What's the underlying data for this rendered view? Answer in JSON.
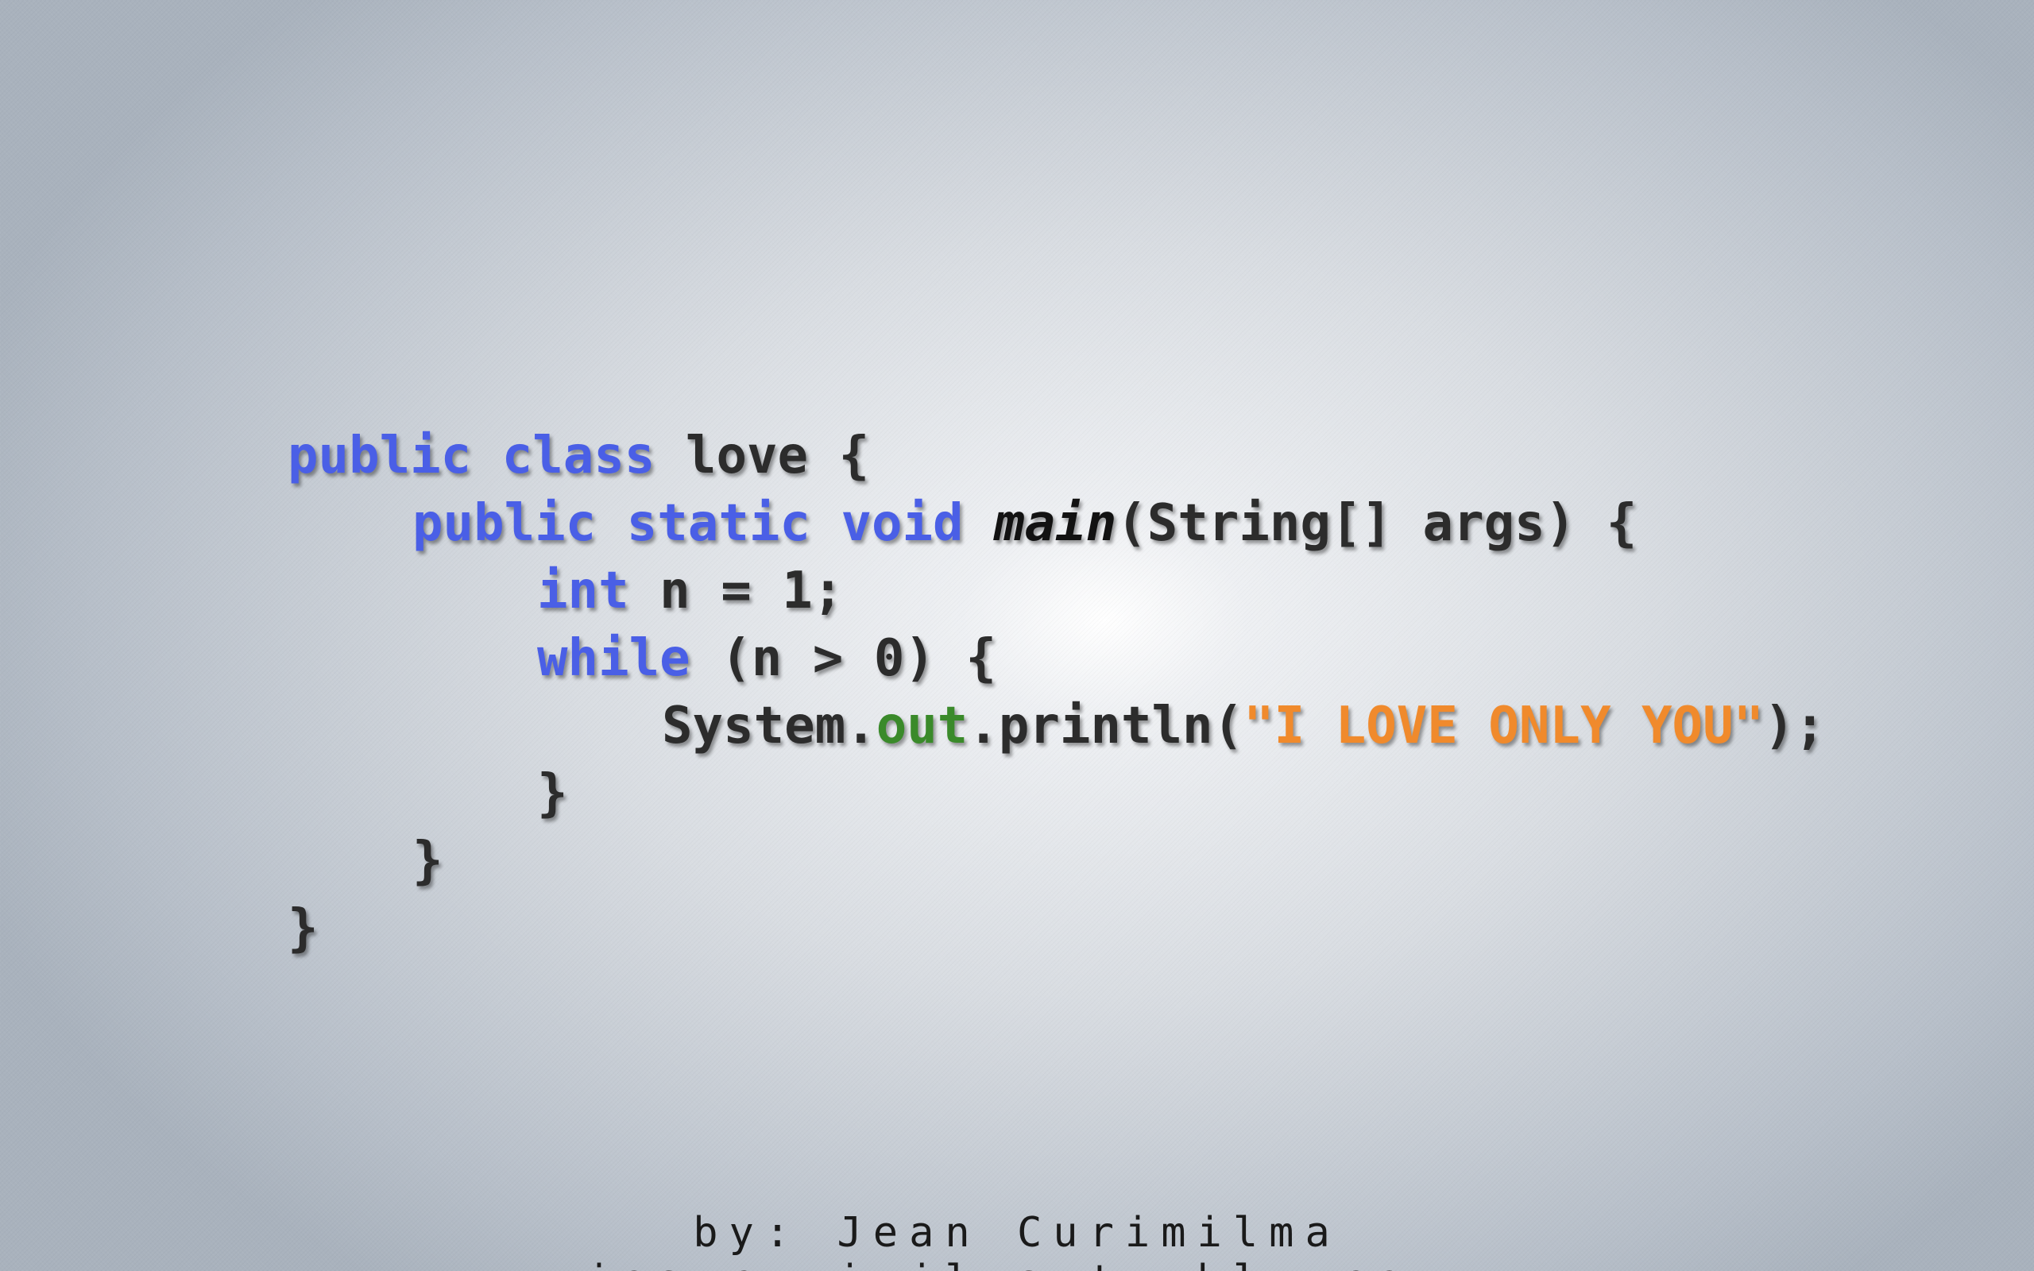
{
  "code": {
    "line1": {
      "kw_public": "public",
      "kw_class": "class",
      "rest": " love {"
    },
    "line2": {
      "kw_public": "public",
      "kw_static": "static",
      "kw_void": "void",
      "method": "main",
      "rest": "(String[] args) {"
    },
    "line3": {
      "kw_int": "int",
      "rest": " n = 1;"
    },
    "line4": {
      "kw_while": "while",
      "rest": " (n > 0) {"
    },
    "line5": {
      "pre": "System.",
      "field": "out",
      "mid": ".println(",
      "string": "\"I LOVE ONLY YOU\"",
      "post": ");"
    },
    "line6": "}",
    "line7": "}",
    "line8": "}"
  },
  "credit": {
    "author": "by: Jean Curimilma",
    "second_line": "jeancurimilma.tumblr.com"
  },
  "colors": {
    "keyword": "#4a5fe6",
    "field": "#3a8a2a",
    "string": "#f08a2c",
    "text": "#2c2c2c"
  }
}
